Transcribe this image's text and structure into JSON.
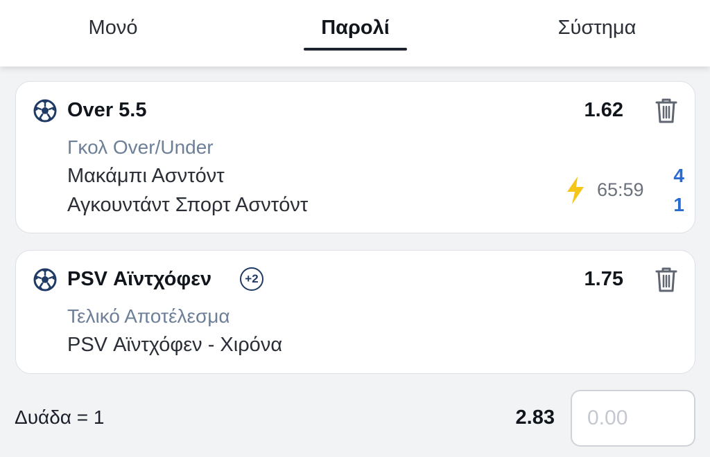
{
  "tabs": [
    {
      "label": "Μονό"
    },
    {
      "label": "Παρολί",
      "active": true
    },
    {
      "label": "Σύστημα"
    }
  ],
  "selections": [
    {
      "icon": "soccer-ball-icon",
      "title": "Over 5.5",
      "odds": "1.62",
      "market": "Γκολ Over/Under",
      "home_team": "Μακάμπι Ασντόντ",
      "away_team": "Αγκουντάντ Σπορτ Ασντόντ",
      "live_icon": "lightning-bolt-icon",
      "match_time": "65:59",
      "home_score": "4",
      "away_score": "1"
    },
    {
      "icon": "soccer-ball-icon",
      "title": "PSV Αϊντχόφεν",
      "extra_badge": "+2",
      "odds": "1.75",
      "market": "Τελικό Αποτέλεσμα",
      "match": "PSV Αϊντχόφεν - Χιρόνα"
    }
  ],
  "footer": {
    "combo_label": "Δυάδα = 1",
    "total_odds": "2.83",
    "stake_placeholder": "0.00"
  },
  "colors": {
    "accent_blue": "#2a6bd1",
    "market_text": "#6e7f98",
    "live_bolt": "#f5c518",
    "badge_navy": "#1f3a64"
  }
}
